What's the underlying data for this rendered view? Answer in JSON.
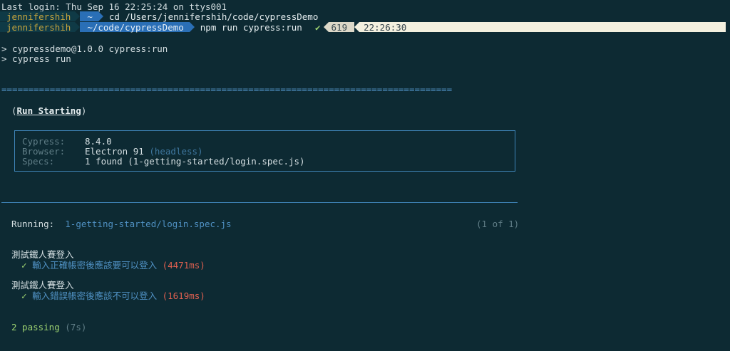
{
  "last_login": "Last login: Thu Sep 16 22:25:24 on ttys001",
  "prompt1": {
    "user": "jennifershih",
    "dir": "~",
    "command": "cd /Users/jennifershih/code/cypressDemo"
  },
  "prompt2": {
    "user": "jennifershih",
    "dir": "~/code/cypressDemo",
    "command": "npm run cypress:run"
  },
  "status": {
    "check": "✔",
    "history": "619",
    "time": "22:26:30"
  },
  "npm_lines": [
    "> cypressdemo@1.0.0 cypress:run",
    "> cypress run"
  ],
  "separator": "====================================================================================",
  "run_starting": {
    "open": "(",
    "label": "Run Starting",
    "close": ")"
  },
  "info": {
    "cypress_key": "Cypress:",
    "cypress_val": "8.4.0",
    "browser_key": "Browser:",
    "browser_val": "Electron 91",
    "browser_mode": "(headless)",
    "specs_key": "Specs:",
    "specs_val": "1 found (1-getting-started/login.spec.js)"
  },
  "running": {
    "label": "Running:",
    "spec": "1-getting-started/login.spec.js",
    "count": "(1 of 1)"
  },
  "suites": [
    {
      "title": "測試鐵人賽登入",
      "check": "✓",
      "test": "輸入正確帳密後應該要可以登入",
      "duration": "(4471ms)"
    },
    {
      "title": "測試鐵人賽登入",
      "check": "✓",
      "test": "輸入錯誤帳密後應該不可以登入",
      "duration": "(1619ms)"
    }
  ],
  "summary": {
    "passing": "2 passing",
    "time": "(7s)"
  },
  "colors": {
    "background": "#0d2a33",
    "accent": "#2a6fb6",
    "pass": "#9bd070",
    "duration": "#e06050"
  }
}
